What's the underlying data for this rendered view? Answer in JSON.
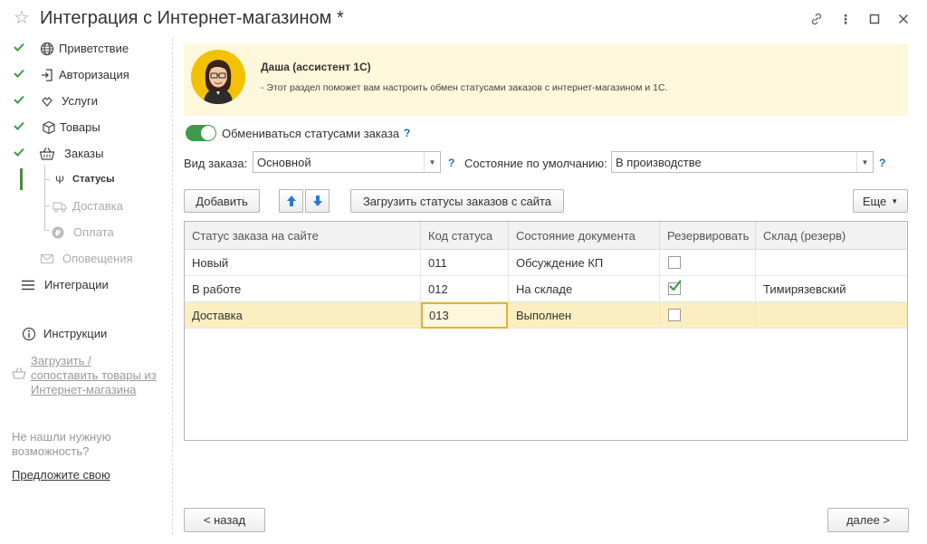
{
  "window": {
    "title": "Интеграция с Интернет-магазином *"
  },
  "sidebar": {
    "items": [
      {
        "label": "Приветствие",
        "icon": "globe-icon",
        "done": true
      },
      {
        "label": "Авторизация",
        "icon": "login-icon",
        "done": true
      },
      {
        "label": "Услуги",
        "icon": "services-icon",
        "done": true
      },
      {
        "label": "Товары",
        "icon": "box-icon",
        "done": true
      },
      {
        "label": "Заказы",
        "icon": "basket-icon",
        "done": true
      },
      {
        "label": "Статусы",
        "icon": "status-icon",
        "active": true
      },
      {
        "label": "Доставка",
        "icon": "truck-icon",
        "disabled": true
      },
      {
        "label": "Оплата",
        "icon": "payment-icon",
        "disabled": true
      },
      {
        "label": "Оповещения",
        "icon": "envelope-icon",
        "disabled": true
      },
      {
        "label": "Интеграции",
        "icon": "menu-icon"
      }
    ],
    "instructions_label": "Инструкции",
    "load_goods_link": [
      "Загрузить /",
      "сопоставить товары из",
      "Интернет-магазина"
    ],
    "hint_text": [
      "Не нашли нужную",
      "возможность?"
    ],
    "suggest_link": "Предложите свою"
  },
  "assistant": {
    "name": "Даша (ассистент 1С)",
    "message": "- Этот раздел поможет вам настроить обмен статусами заказов с интернет-магазином и 1С."
  },
  "form": {
    "exchange_toggle_label": "Обмениваться статусами заказа",
    "exchange_toggle_on": true,
    "help_glyph": "?",
    "order_type_label": "Вид заказа:",
    "order_type_value": "Основной",
    "default_state_label": "Состояние по умолчанию:",
    "default_state_value": "В производстве"
  },
  "toolbar": {
    "add_label": "Добавить",
    "load_statuses_label": "Загрузить статусы заказов с сайта",
    "more_label": "Еще"
  },
  "table": {
    "columns": [
      "Статус заказа на сайте",
      "Код статуса",
      "Состояние документа",
      "Резервировать",
      "Склад (резерв)"
    ],
    "rows": [
      {
        "status": "Новый",
        "code": "011",
        "state": "Обсуждение КП",
        "reserve": false,
        "warehouse": ""
      },
      {
        "status": "В работе",
        "code": "012",
        "state": "На складе",
        "reserve": true,
        "warehouse": "Тимирязевский"
      },
      {
        "status": "Доставка",
        "code": "013",
        "state": "Выполнен",
        "reserve": false,
        "warehouse": ""
      }
    ]
  },
  "footer": {
    "back_label": "< назад",
    "next_label": "далее >"
  },
  "colors": {
    "accent_green": "#3c9a4a",
    "selected_row": "#fbeec0",
    "assistant_bg": "#fdf8dc",
    "help_blue": "#1a6eb8"
  }
}
